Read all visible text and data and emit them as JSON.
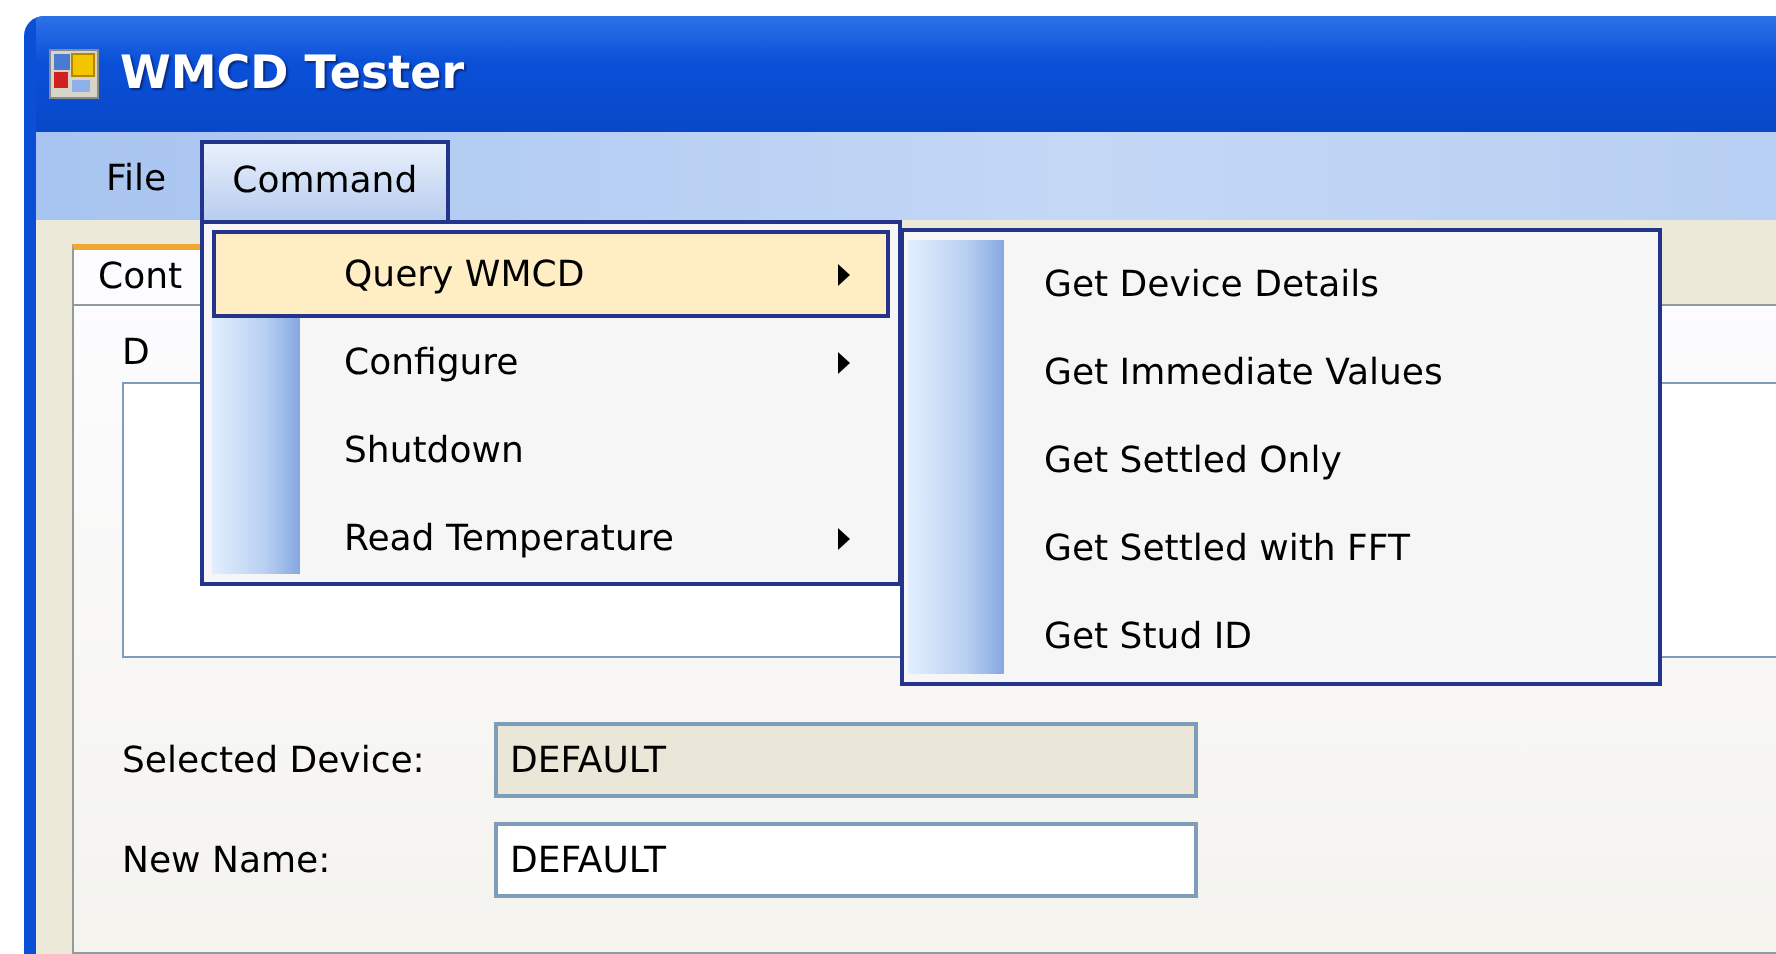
{
  "window": {
    "title": "WMCD Tester"
  },
  "menu_bar": [
    {
      "label": "File",
      "selected": false
    },
    {
      "label": "Command",
      "selected": true
    }
  ],
  "tab": {
    "label": "Cont",
    "selected": true
  },
  "group": {
    "label": "D"
  },
  "command_menu": [
    {
      "label": "Query WMCD",
      "highlighted": true,
      "has_submenu": true
    },
    {
      "label": "Configure",
      "highlighted": false,
      "has_submenu": true
    },
    {
      "label": "Shutdown",
      "highlighted": false,
      "has_submenu": false
    },
    {
      "label": "Read Temperature",
      "highlighted": false,
      "has_submenu": true
    }
  ],
  "submenu": [
    {
      "label": "Get Device Details",
      "highlighted": false
    },
    {
      "label": "Get Immediate Values",
      "highlighted": false
    },
    {
      "label": "Get Settled Only",
      "highlighted": false
    },
    {
      "label": "Get Settled with FFT",
      "highlighted": false
    },
    {
      "label": "Get Stud ID",
      "highlighted": false
    }
  ],
  "fields": [
    {
      "label": "Selected Device:",
      "value": "DEFAULT",
      "disabled": true
    },
    {
      "label": "New Name:",
      "value": "DEFAULT",
      "disabled": false
    }
  ]
}
